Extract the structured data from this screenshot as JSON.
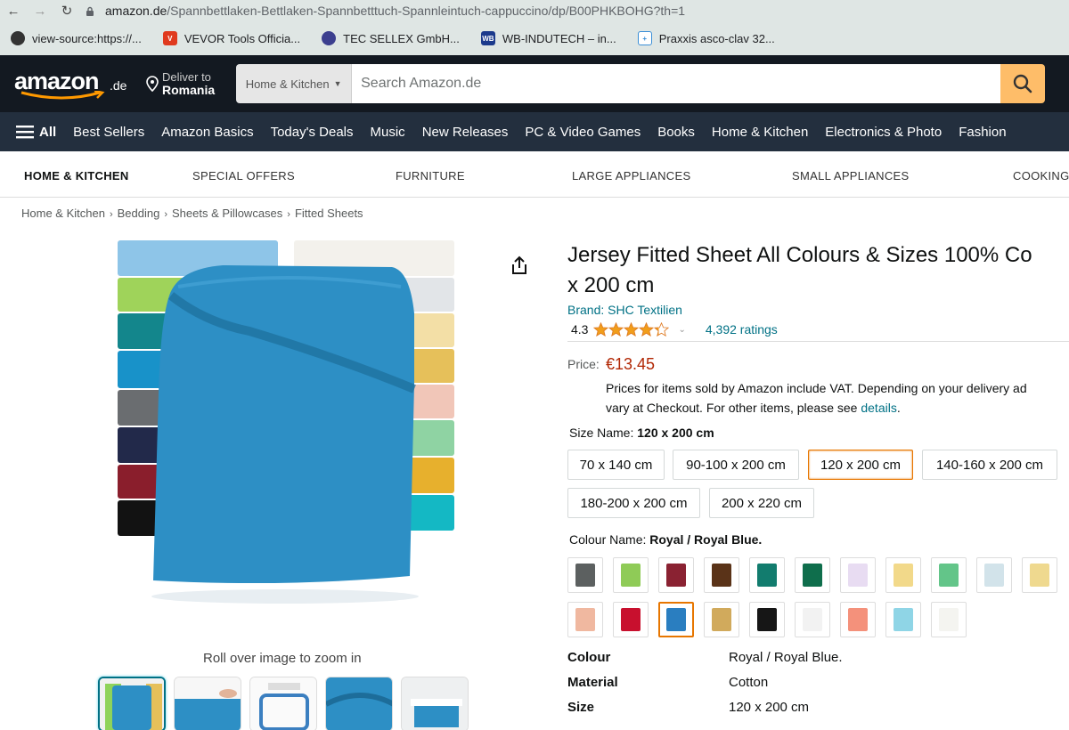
{
  "browser": {
    "url_host": "amazon.de",
    "url_path": "/Spannbettlaken-Bettlaken-Spannbetttuch-Spannleintuch-cappuccino/dp/B00PHKBOHG?th=1",
    "bookmarks": [
      {
        "label": "view-source:https://..."
      },
      {
        "label": "VEVOR Tools Officia..."
      },
      {
        "label": "TEC SELLEX GmbH..."
      },
      {
        "label": "WB-INDUTECH – in..."
      },
      {
        "label": "Praxxis asco-clav 32..."
      }
    ]
  },
  "header": {
    "logo": "amazon",
    "logo_tld": ".de",
    "deliver_to": "Deliver to",
    "deliver_country": "Romania",
    "search_category": "Home & Kitchen",
    "search_placeholder": "Search Amazon.de"
  },
  "nav": {
    "all": "All",
    "links": [
      "Best Sellers",
      "Amazon Basics",
      "Today's Deals",
      "Music",
      "New Releases",
      "PC & Video Games",
      "Books",
      "Home & Kitchen",
      "Electronics & Photo",
      "Fashion"
    ]
  },
  "subnav": [
    "HOME & KITCHEN",
    "SPECIAL OFFERS",
    "FURNITURE",
    "LARGE APPLIANCES",
    "SMALL APPLIANCES",
    "COOKING &"
  ],
  "breadcrumb": [
    "Home & Kitchen",
    "Bedding",
    "Sheets & Pillowcases",
    "Fitted Sheets"
  ],
  "gallery": {
    "zoom_hint": "Roll over image to zoom in"
  },
  "product": {
    "title_line1": "Jersey Fitted Sheet All Colours & Sizes 100% Co",
    "title_line2": "x 200 cm",
    "brand": "Brand: SHC Textilien",
    "rating_value": "4.3",
    "rating_stars": 4.3,
    "ratings_count": "4,392 ratings",
    "price_label": "Price:",
    "price": "€13.45",
    "vat_line1": "Prices for items sold by Amazon include VAT. Depending on your delivery ad",
    "vat_line2": "vary at Checkout. For other items, please see",
    "vat_link": "details",
    "size_label": "Size Name:",
    "size_selected": "120 x 200 cm",
    "sizes": [
      "70 x 140 cm",
      "90-100 x 200 cm",
      "120 x 200 cm",
      "140-160 x 200 cm",
      "180-200 x 200 cm",
      "200 x 220 cm"
    ],
    "colour_label": "Colour Name:",
    "colour_selected": "Royal / Royal Blue.",
    "swatch_colors": [
      "#5c6060",
      "#8fcb57",
      "#8a2232",
      "#5a3318",
      "#127c6e",
      "#0f6e4c",
      "#e8dcf2",
      "#f2d98a",
      "#63c589",
      "#d2e3ea",
      "#efd98f",
      "#f0b8a0",
      "#c8102e",
      "#2a7ec0",
      "#d1aa5c",
      "#161616",
      "#f2f2f2",
      "#f4917b",
      "#8fd5e6",
      "#f4f4f0"
    ],
    "specs": [
      {
        "k": "Colour",
        "v": "Royal / Royal Blue."
      },
      {
        "k": "Material",
        "v": "Cotton"
      },
      {
        "k": "Size",
        "v": "120 x 200 cm"
      }
    ]
  }
}
